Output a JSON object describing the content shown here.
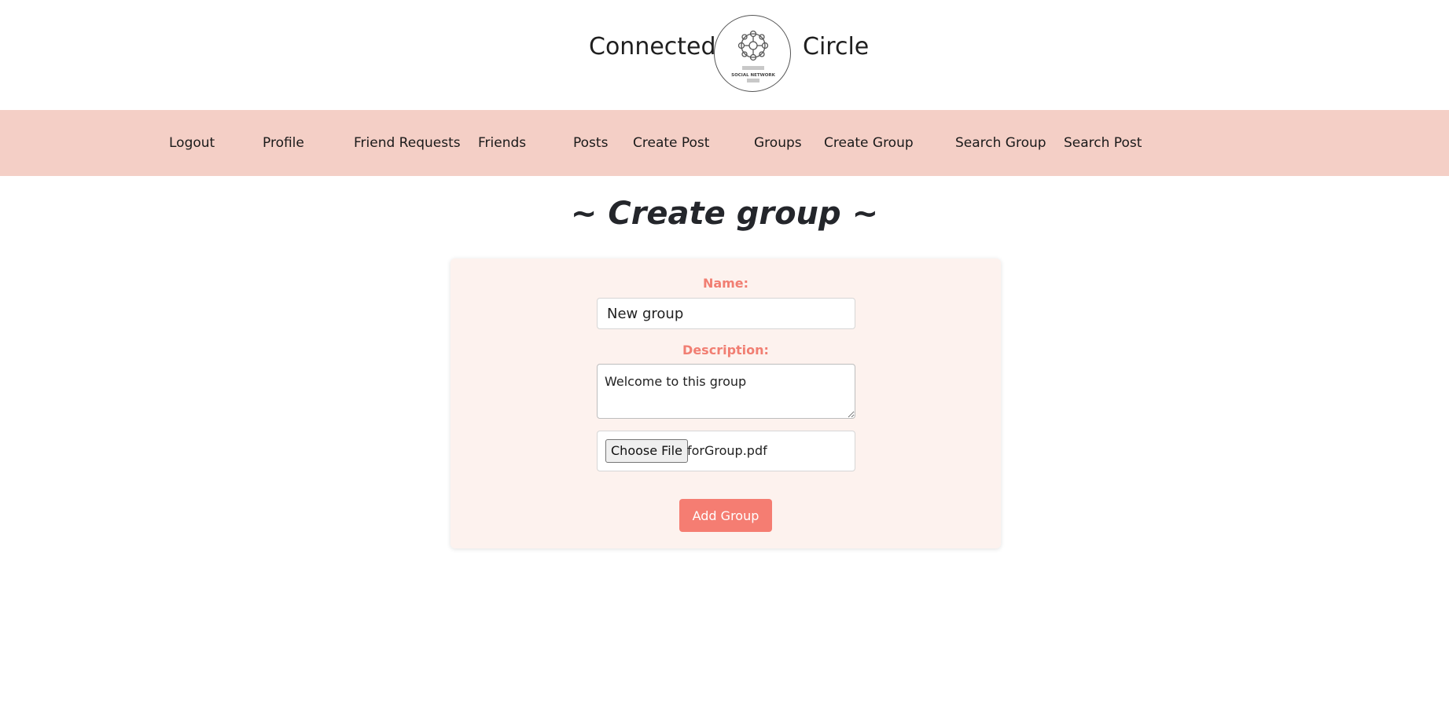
{
  "header": {
    "brand_left": "Connected",
    "brand_right": "Circle",
    "logo_text": "SOCIAL NETWORK",
    "logo_icon": "network-logo-icon"
  },
  "nav": {
    "items": [
      {
        "label": "Logout"
      },
      {
        "label": "Profile"
      },
      {
        "label": "Friend Requests"
      },
      {
        "label": "Friends"
      },
      {
        "label": "Posts"
      },
      {
        "label": "Create Post"
      },
      {
        "label": "Groups"
      },
      {
        "label": "Create Group"
      },
      {
        "label": "Search Group"
      },
      {
        "label": "Search Post"
      }
    ]
  },
  "main": {
    "title": "~ Create group ~",
    "form": {
      "name_label": "Name:",
      "name_value": "New group",
      "description_label": "Description:",
      "description_value": "Welcome to this group",
      "file_button_label": "Choose File",
      "file_name": "forGroup.pdf",
      "submit_label": "Add Group"
    }
  },
  "colors": {
    "nav_background": "#f4cfc6",
    "card_background": "#fdf2ee",
    "label_accent": "#f17e72",
    "button_background": "#f57d72"
  }
}
